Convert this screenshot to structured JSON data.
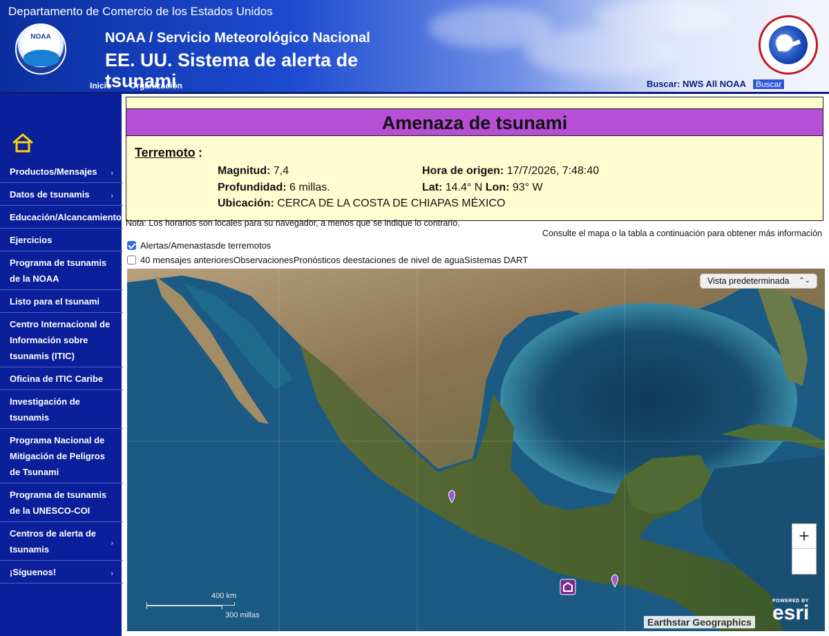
{
  "header": {
    "department": "Departamento de Comercio de los Estados Unidos",
    "org_title": "NOAA / Servicio Meteorológico Nacional",
    "system_title": "EE. UU. Sistema de alerta de tsunami",
    "noaa_logo_text": "NOAA",
    "nav": {
      "home": "Inicio",
      "organization": "Organización"
    },
    "search": {
      "label": "Buscar:",
      "scope": "NWS All NOAA",
      "button": "Buscar"
    }
  },
  "sidebar": {
    "items": [
      {
        "label": "Productos/Mensajes",
        "has_submenu": true
      },
      {
        "label": "Datos de tsunamis",
        "has_submenu": true
      },
      {
        "label": "Educación/Alcancamiento",
        "has_submenu": false
      },
      {
        "label": "Ejercicios",
        "has_submenu": false
      },
      {
        "label": "Programa de tsunamis de la NOAA",
        "has_submenu": false
      },
      {
        "label": "Listo para el tsunami",
        "has_submenu": false
      },
      {
        "label": "Centro Internacional de Información sobre tsunamis (ITIC)",
        "has_submenu": false
      },
      {
        "label": "Oficina de ITIC Caribe",
        "has_submenu": false
      },
      {
        "label": "Investigación de tsunamis",
        "has_submenu": false
      },
      {
        "label": "Programa Nacional de Mitigación de Peligros de Tsunami",
        "has_submenu": false
      },
      {
        "label": "Programa de tsunamis de la UNESCO-COI",
        "has_submenu": false
      },
      {
        "label": "Centros de alerta de tsunamis",
        "has_submenu": true
      },
      {
        "label": "¡Síguenos!",
        "has_submenu": true
      }
    ]
  },
  "alert": {
    "title": "Amenaza de tsunami",
    "title_color": "#b64ed6",
    "section_label": "Terremoto",
    "magnitude_label": "Magnitud:",
    "magnitude": "7,4",
    "depth_label": "Profundidad:",
    "depth": "6 millas.",
    "location_label": "Ubicación:",
    "location": "CERCA DE LA COSTA DE CHIAPAS MÉXICO",
    "origin_label": "Hora de origen:",
    "origin_time": "17/7/2026, 7:48:40",
    "lat_label": "Lat:",
    "lat": "14.4° N",
    "lon_label": "Lon:",
    "lon": "93° W"
  },
  "note": "Nota: Los horarios son locales para su navegador, a menos que se indique lo contrario.",
  "consult": "Consulte el mapa o la tabla a continuación para obtener más información",
  "layers": {
    "row1": [
      {
        "label": "Alertas/Amenastas",
        "checked": true
      },
      {
        "label": "de terremotos"
      }
    ],
    "row2": [
      {
        "label": "40 mensajes anteriores",
        "checked": false
      },
      {
        "label": "Observaciones"
      },
      {
        "label": "Pronósticos de"
      },
      {
        "label": "estaciones de nivel de agua"
      },
      {
        "label": "Sistemas DART"
      }
    ]
  },
  "map": {
    "view_select": "Vista predeterminada",
    "zoom_in": "+",
    "scale_km": "400 km",
    "scale_mi": "300 millas",
    "attribution": "Earthstar Geographics",
    "esri_powered": "POWERED BY",
    "esri_name": "esri",
    "marker_color": "#9b59d6"
  }
}
